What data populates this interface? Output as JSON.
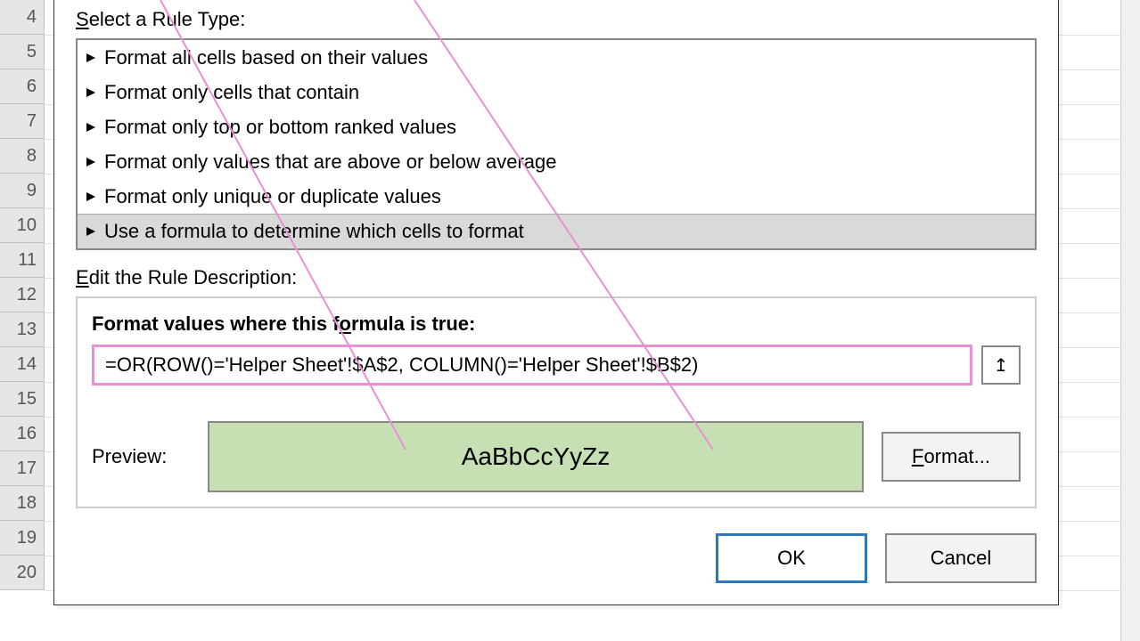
{
  "rows": [
    "4",
    "5",
    "6",
    "7",
    "8",
    "9",
    "10",
    "11",
    "12",
    "13",
    "14",
    "15",
    "16",
    "17",
    "18",
    "19",
    "20"
  ],
  "dialog": {
    "select_label_prefix": "S",
    "select_label_rest": "elect a Rule Type:",
    "rule_types": [
      "Format all cells based on their values",
      "Format only cells that contain",
      "Format only top or bottom ranked values",
      "Format only values that are above or below average",
      "Format only unique or duplicate values",
      "Use a formula to determine which cells to format"
    ],
    "selected_index": 5,
    "edit_label_prefix": "E",
    "edit_label_rest": "dit the Rule Description:",
    "formula_label_prefix": "F",
    "formula_label_rest": "ormat values where this f",
    "formula_label_mid": "o",
    "formula_label_end": "rmula is true:",
    "formula_value": "=OR(ROW()='Helper Sheet'!$A$2, COLUMN()='Helper Sheet'!$B$2)",
    "preview_label": "Preview:",
    "preview_text": "AaBbCcYyZz",
    "format_btn_prefix": "F",
    "format_btn_rest": "ormat...",
    "ok": "OK",
    "cancel": "Cancel"
  }
}
